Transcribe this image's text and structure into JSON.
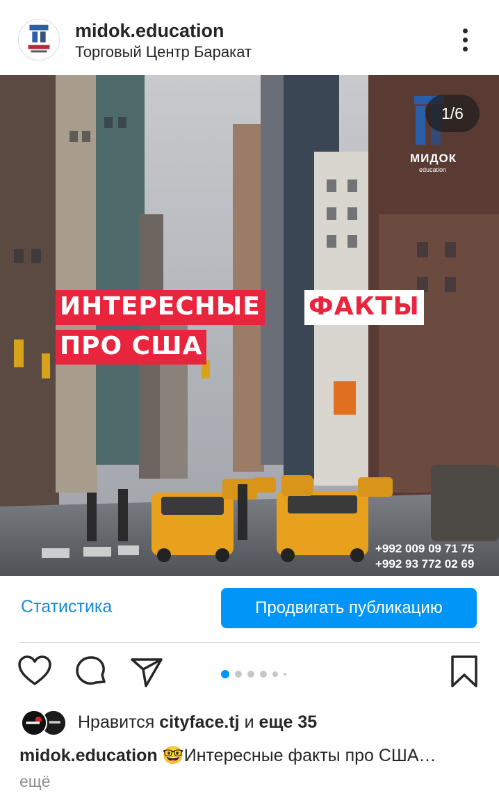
{
  "post": {
    "username": "midok.education",
    "location": "Торговый Центр Баракат",
    "counter": "1/6",
    "brand_name": "МИДОК",
    "brand_sub": "education",
    "headline_part1": "ИНТЕРЕСНЫЕ",
    "headline_part2": "ФАКТЫ",
    "headline_part3": "ПРО США",
    "phone1": "+992 009 09 71 75",
    "phone2": "+992 93 772 02 69"
  },
  "actions": {
    "stats_label": "Статистика",
    "promote_label": "Продвигать публикацию"
  },
  "icons": {
    "like": "heart-icon",
    "comment": "comment-icon",
    "share": "send-icon",
    "save": "bookmark-icon"
  },
  "carousel": {
    "total": 6,
    "active_index": 1
  },
  "likes": {
    "prefix": "Нравится",
    "user": "cityface.tj",
    "joiner": "и",
    "others": "еще 35"
  },
  "caption": {
    "username": "midok.education",
    "emoji": "🤓",
    "text": "Интересные факты про США…",
    "more": "ещё"
  },
  "colors": {
    "accent_blue": "#0095f6",
    "link_blue": "#1a8bd8",
    "headline_red": "#e8253d",
    "taxi_yellow": "#e8a11c"
  }
}
